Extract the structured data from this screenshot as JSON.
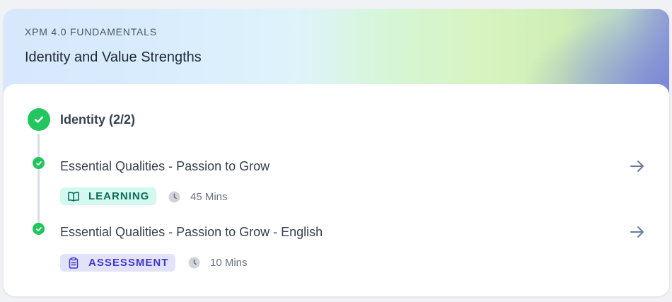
{
  "header": {
    "eyebrow": "XPM 4.0 FUNDAMENTALS",
    "title": "Identity and Value Strengths"
  },
  "section": {
    "title": "Identity (2/2)",
    "status_icon": "check-circle-icon",
    "complete_color": "#22c55e"
  },
  "items": [
    {
      "title": "Essential Qualities - Passion to Grow",
      "type_label": "LEARNING",
      "type_icon": "book-open-icon",
      "duration": "45 Mins",
      "completed": true
    },
    {
      "title": "Essential Qualities - Passion to Grow - English",
      "type_label": "ASSESSMENT",
      "type_icon": "clipboard-icon",
      "duration": "10 Mins",
      "completed": true
    }
  ],
  "colors": {
    "learning_badge_bg": "#d3f8ef",
    "learning_badge_text": "#0f6b5c",
    "assessment_badge_bg": "#e1e3fb",
    "assessment_badge_text": "#4338ca",
    "arrow": "#6b7a99"
  }
}
